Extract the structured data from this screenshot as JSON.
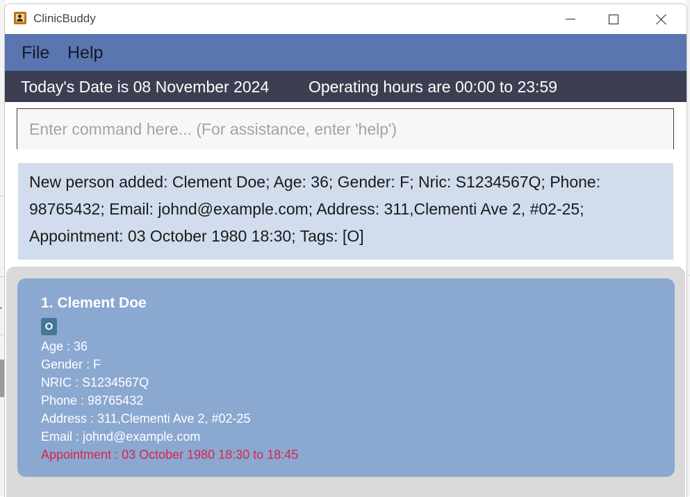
{
  "window": {
    "title": "ClinicBuddy"
  },
  "menu": {
    "file": "File",
    "help": "Help"
  },
  "status": {
    "date_text": "Today's Date is 08 November 2024",
    "hours_text": "Operating hours are 00:00 to 23:59"
  },
  "command": {
    "placeholder": "Enter command here... (For assistance, enter 'help')",
    "value": ""
  },
  "result": {
    "message": "New person added: Clement Doe; Age: 36; Gender: F; Nric: S1234567Q; Phone: 98765432; Email: johnd@example.com; Address: 311,Clementi Ave 2, #02-25; Appointment: 03 October 1980 18:30; Tags: [O]"
  },
  "persons": [
    {
      "title": "1. Clement Doe",
      "tags": [
        "O"
      ],
      "age": "Age : 36",
      "gender": "Gender : F",
      "nric": "NRIC : S1234567Q",
      "phone": "Phone : 98765432",
      "address": "Address : 311,Clementi Ave 2, #02-25",
      "email": "Email : johnd@example.com",
      "appointment": "Appointment : 03 October 1980 18:30 to 18:45"
    }
  ],
  "colors": {
    "menubar": "#5b75b1",
    "statusbar": "#3b3f51",
    "result_bg": "#d1dcec",
    "card_bg": "#8ba8d1",
    "tag_bg": "#427796",
    "appointment_text": "#d8254a"
  },
  "icons": {
    "app": "contact-book-icon",
    "minimize": "minimize-icon",
    "maximize": "maximize-icon",
    "close": "close-icon"
  }
}
